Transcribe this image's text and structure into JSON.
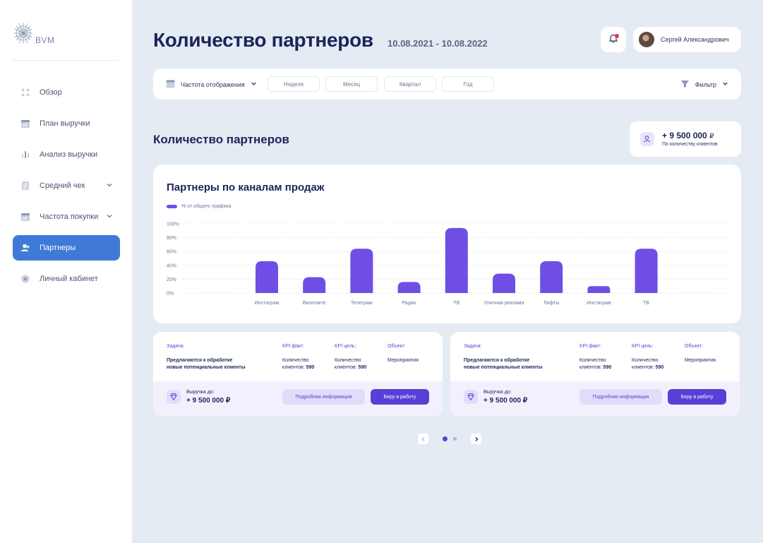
{
  "brand": {
    "logo_text": "BVM"
  },
  "sidebar": {
    "items": [
      {
        "label": "Обзор",
        "icon": "dots-grid-icon",
        "active": false
      },
      {
        "label": "План выручки",
        "icon": "calendar-chart-icon",
        "active": false
      },
      {
        "label": "Анализ выручки",
        "icon": "bars-icon",
        "active": false
      },
      {
        "label": "Средний чек",
        "icon": "document-icon",
        "active": false,
        "expandable": true
      },
      {
        "label": "Частота покупки",
        "icon": "calendar-chart-icon",
        "active": false,
        "expandable": true
      },
      {
        "label": "Партнеры",
        "icon": "users-icon",
        "active": true
      },
      {
        "label": "Личный кабинет",
        "icon": "gear-icon",
        "active": false
      }
    ]
  },
  "header": {
    "title": "Количество партнеров",
    "date_range": "10.08.2021 - 10.08.2022",
    "user_name": "Сергей Александрович"
  },
  "filterbar": {
    "frequency_label": "Частота отображения",
    "segments": [
      "Неделя",
      "Месяц",
      "Квартал",
      "Год"
    ],
    "filter_label": "Фильтр"
  },
  "section": {
    "title": "Количество партнеров",
    "metric_value": "+ 9 500 000",
    "currency": "₽",
    "metric_caption": "По количеству клиентов"
  },
  "chart_card": {
    "title": "Партнеры по каналам продаж",
    "legend": "% от общего трафика"
  },
  "chart_data": {
    "type": "bar",
    "title": "Партнеры по каналам продаж",
    "categories": [
      "Инстаграм",
      "Вконтакте",
      "Телеграм",
      "Радио",
      "ТВ",
      "Уличная реклама",
      "Лифты",
      "Инстаграм",
      "ТВ"
    ],
    "series": [
      {
        "name": "% от общего трафика",
        "values": [
          46,
          23,
          64,
          16,
          94,
          28,
          46,
          10,
          64
        ]
      }
    ],
    "y_ticks": [
      "100%",
      "80%",
      "60%",
      "40%",
      "20%",
      "0%"
    ],
    "ylim": [
      0,
      100
    ],
    "grid": true,
    "bar_color": "#6f4ee6"
  },
  "kpi_cards": [
    {
      "task_label": "Задача:",
      "task_text_1": "Предлагаются к обработке",
      "task_text_2": "новые потенциальные клиенты",
      "kpi_fact_label": "KPI факт:",
      "kpi_fact_text": "Количество",
      "kpi_fact_prefix": "клиентов:",
      "kpi_fact_value": "590",
      "kpi_goal_label": "KPI цель:",
      "kpi_goal_text": "Количество",
      "kpi_goal_prefix": "клиентов:",
      "kpi_goal_value": "590",
      "object_label": "Объект:",
      "object_text": "Мероприятия",
      "revenue_label": "Выручка до:",
      "revenue_value": "+ 9 500 000 ₽",
      "more_button": "Подробная информация",
      "work_button": "Беру в работу"
    },
    {
      "task_label": "Задача:",
      "task_text_1": "Предлагаются к обработке",
      "task_text_2": "новые потенциальные клиенты",
      "kpi_fact_label": "KPI факт:",
      "kpi_fact_text": "Количество",
      "kpi_fact_prefix": "клиентов:",
      "kpi_fact_value": "590",
      "kpi_goal_label": "KPI цель:",
      "kpi_goal_text": "Количество",
      "kpi_goal_prefix": "клиентов:",
      "kpi_goal_value": "590",
      "object_label": "Объект:",
      "object_text": "Мероприятия",
      "revenue_label": "Выручка до:",
      "revenue_value": "+ 9 500 000 ₽",
      "more_button": "Подробная информация",
      "work_button": "Беру в работу"
    }
  ],
  "pager": {
    "pages": 2,
    "current": 1
  },
  "colors": {
    "accent": "#5a3fd6",
    "bar": "#6f4ee6",
    "active_nav": "#3f7ad6",
    "background": "#e4ebf3"
  }
}
